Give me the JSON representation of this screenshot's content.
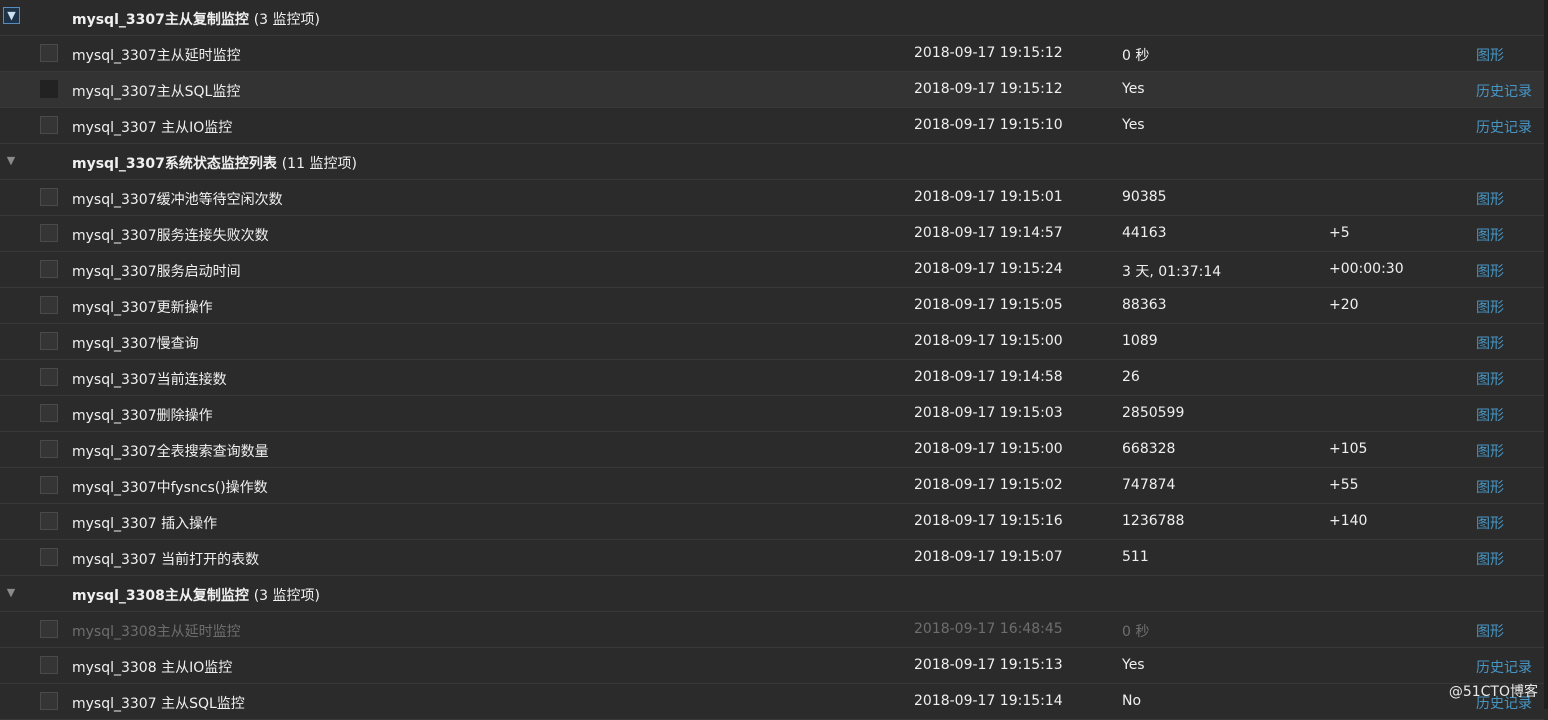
{
  "groups": [
    {
      "name": "mysql_3307主从复制监控",
      "count": "(3 监控项)",
      "toggle_active": true,
      "items": [
        {
          "name": "mysql_3307主从延时监控",
          "time": "2018-09-17 19:15:12",
          "value": "0 秒",
          "change": "",
          "link": "图形"
        },
        {
          "name": "mysql_3307主从SQL监控",
          "time": "2018-09-17 19:15:12",
          "value": "Yes",
          "change": "",
          "link": "历史记录",
          "hover": true
        },
        {
          "name": "mysql_3307 主从IO监控",
          "time": "2018-09-17 19:15:10",
          "value": "Yes",
          "change": "",
          "link": "历史记录"
        }
      ]
    },
    {
      "name": "mysql_3307系统状态监控列表",
      "count": "(11 监控项)",
      "toggle_active": false,
      "items": [
        {
          "name": "mysql_3307缓冲池等待空闲次数",
          "time": "2018-09-17 19:15:01",
          "value": "90385",
          "change": "",
          "link": "图形"
        },
        {
          "name": "mysql_3307服务连接失败次数",
          "time": "2018-09-17 19:14:57",
          "value": "44163",
          "change": "+5",
          "link": "图形"
        },
        {
          "name": "mysql_3307服务启动时间",
          "time": "2018-09-17 19:15:24",
          "value": "3 天, 01:37:14",
          "change": "+00:00:30",
          "link": "图形"
        },
        {
          "name": "mysql_3307更新操作",
          "time": "2018-09-17 19:15:05",
          "value": "88363",
          "change": "+20",
          "link": "图形"
        },
        {
          "name": "mysql_3307慢查询",
          "time": "2018-09-17 19:15:00",
          "value": "1089",
          "change": "",
          "link": "图形"
        },
        {
          "name": "mysql_3307当前连接数",
          "time": "2018-09-17 19:14:58",
          "value": "26",
          "change": "",
          "link": "图形"
        },
        {
          "name": "mysql_3307删除操作",
          "time": "2018-09-17 19:15:03",
          "value": "2850599",
          "change": "",
          "link": "图形"
        },
        {
          "name": "mysql_3307全表搜索查询数量",
          "time": "2018-09-17 19:15:00",
          "value": "668328",
          "change": "+105",
          "link": "图形"
        },
        {
          "name": "mysql_3307中fysncs()操作数",
          "time": "2018-09-17 19:15:02",
          "value": "747874",
          "change": "+55",
          "link": "图形"
        },
        {
          "name": "mysql_3307 插入操作",
          "time": "2018-09-17 19:15:16",
          "value": "1236788",
          "change": "+140",
          "link": "图形"
        },
        {
          "name": "mysql_3307 当前打开的表数",
          "time": "2018-09-17 19:15:07",
          "value": "511",
          "change": "",
          "link": "图形"
        }
      ]
    },
    {
      "name": "mysql_3308主从复制监控",
      "count": "(3 监控项)",
      "toggle_active": false,
      "items": [
        {
          "name": "mysql_3308主从延时监控",
          "time": "2018-09-17 16:48:45",
          "value": "0 秒",
          "change": "",
          "link": "图形",
          "disabled": true
        },
        {
          "name": "mysql_3308 主从IO监控",
          "time": "2018-09-17 19:15:13",
          "value": "Yes",
          "change": "",
          "link": "历史记录"
        },
        {
          "name": "mysql_3307 主从SQL监控",
          "time": "2018-09-17 19:15:14",
          "value": "No",
          "change": "",
          "link": "历史记录"
        }
      ]
    }
  ],
  "toggle_glyph": "▼",
  "watermark": "@51CTO博客",
  "colors": {
    "background": "#2b2b2b",
    "link": "#4796c4",
    "disabled_text": "#6e6e6e",
    "row_hover": "#333333"
  }
}
